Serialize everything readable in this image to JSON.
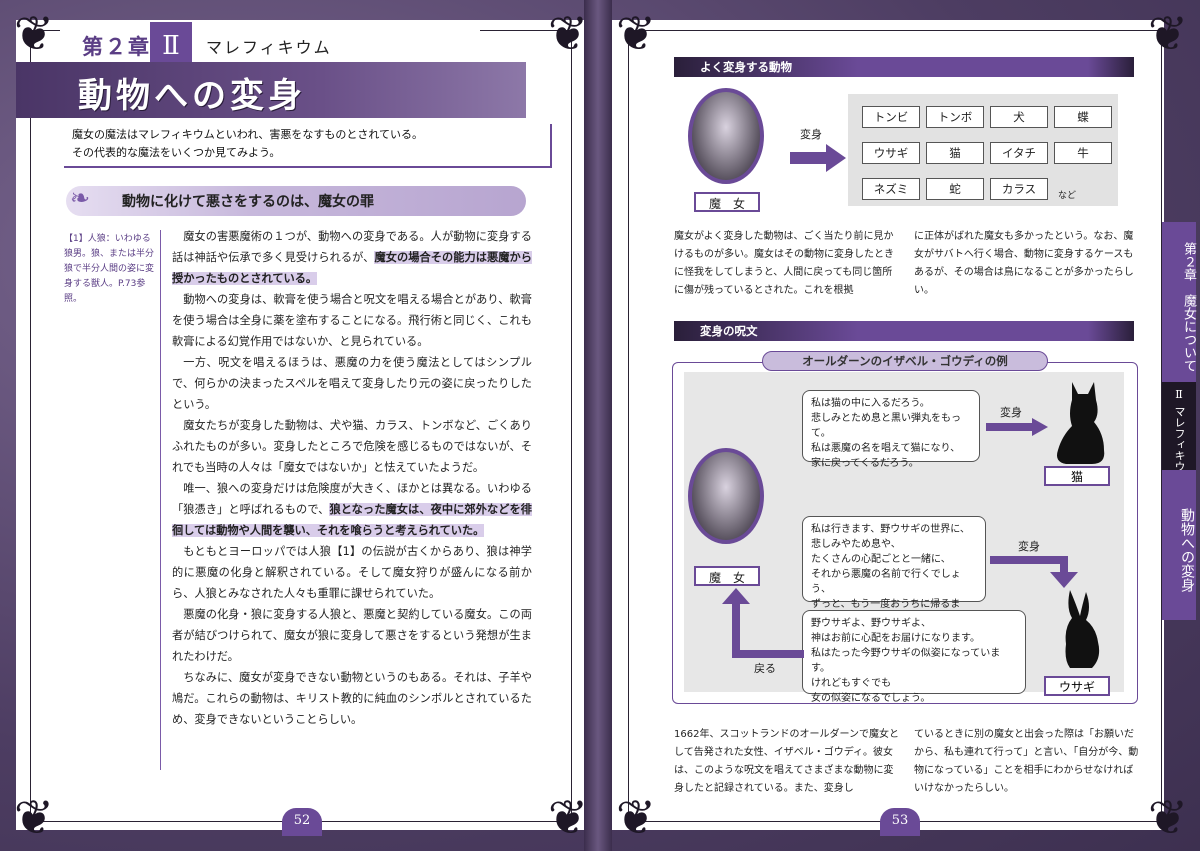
{
  "left": {
    "chapter": "第２章",
    "roman": "Ⅱ",
    "chapter_name": "マレフィキウム",
    "title": "動物への変身",
    "intro_1": "魔女の魔法はマレフィキウムといわれ、害悪をなすものとされている。",
    "intro_2": "その代表的な魔法をいくつか見てみよう。",
    "section": "動物に化けて悪さをするのは、魔女の罪",
    "note": "【1】人狼：いわゆる狼男。狼、または半分狼で半分人間の姿に変身する獣人。P.73参照。",
    "p1a": "魔女の害悪魔術の１つが、動物への変身である。人が動物に変身する話は神話や伝承で多く見受けられるが、",
    "p1hl": "魔女の場合その能力は悪魔から授かったものとされている。",
    "p2": "動物への変身は、軟膏を使う場合と呪文を唱える場合とがあり、軟膏を使う場合は全身に薬を塗布することになる。飛行術と同じく、これも軟膏による幻覚作用ではないか、と見られている。",
    "p3": "一方、呪文を唱えるほうは、悪魔の力を使う魔法としてはシンプルで、何らかの決まったスペルを唱えて変身したり元の姿に戻ったりしたという。",
    "p4": "魔女たちが変身した動物は、犬や猫、カラス、トンボなど、ごくありふれたものが多い。変身したところで危険を感じるものではないが、それでも当時の人々は「魔女ではないか」と怯えていたようだ。",
    "p5a": "唯一、狼への変身だけは危険度が大きく、ほかとは異なる。いわゆる「狼憑き」と呼ばれるもので、",
    "p5hl": "狼となった魔女は、夜中に郊外などを徘徊しては動物や人間を襲い、それを喰らうと考えられていた。",
    "p6": "もともとヨーロッパでは人狼【1】の伝説が古くからあり、狼は神学的に悪魔の化身と解釈されている。そして魔女狩りが盛んになる前から、人狼とみなされた人々も重罪に課せられていた。",
    "p7": "悪魔の化身・狼に変身する人狼と、悪魔と契約している魔女。この両者が結びつけられて、魔女が狼に変身して悪さをするという発想が生まれたわけだ。",
    "p8": "ちなみに、魔女が変身できない動物というのもある。それは、子羊や鳩だ。これらの動物は、キリスト教的に純血のシンボルとされているため、変身できないということらしい。",
    "page": "52"
  },
  "right": {
    "sec1": "よく変身する動物",
    "witch": "魔　女",
    "henshin": "変身",
    "animals": [
      "トンビ",
      "トンボ",
      "犬",
      "蝶",
      "ウサギ",
      "猫",
      "イタチ",
      "牛",
      "ネズミ",
      "蛇",
      "カラス"
    ],
    "etc": "など",
    "col1": "魔女がよく変身した動物は、ごく当たり前に見かけるものが多い。魔女はその動物に変身したときに怪我をしてしまうと、人間に戻っても同じ箇所に傷が残っているとされた。これを根拠",
    "col2": "に正体がばれた魔女も多かったという。なお、魔女がサバトへ行く場合、動物に変身するケースもあるが、その場合は鳥になることが多かったらしい。",
    "sec2": "変身の呪文",
    "example": "オールダーンのイザベル・ゴウディの例",
    "spell_cat": [
      "私は猫の中に入るだろう。",
      "悲しみとため息と黒い弾丸をもって。",
      "私は悪魔の名を唱えて猫になり、",
      "家に戻ってくるだろう。"
    ],
    "cat": "猫",
    "spell_hare": [
      "私は行きます、野ウサギの世界に、",
      "悲しみやため息や、",
      "たくさんの心配ごとと一緒に、",
      "それから悪魔の名前で行くでしょう、",
      "ずっと、もう一度おうちに帰るまで。"
    ],
    "spell_back": [
      "野ウサギよ、野ウサギよ、",
      "神はお前に心配をお届けになります。",
      "私はたった今野ウサギの似姿になっています。",
      "けれどもすぐでも",
      "女の似姿になるでしょう。"
    ],
    "hare": "ウサギ",
    "back": "戻る",
    "col3": "1662年、スコットランドのオールダーンで魔女として告発された女性、イザベル・ゴウディ。彼女は、このような呪文を唱えてさまざまな動物に変身したと記録されている。また、変身し",
    "col4": "ているときに別の魔女と出会った際は「お願いだから、私も連れて行って」と言い、「自分が今、動物になっている」ことを相手にわからせなければいけなかったらしい。",
    "tab_chapter": "第２章　魔女について",
    "tab_roman": "Ⅱ",
    "tab_name": "マレフィキウム",
    "tab_title": "動物への変身",
    "page": "53"
  }
}
